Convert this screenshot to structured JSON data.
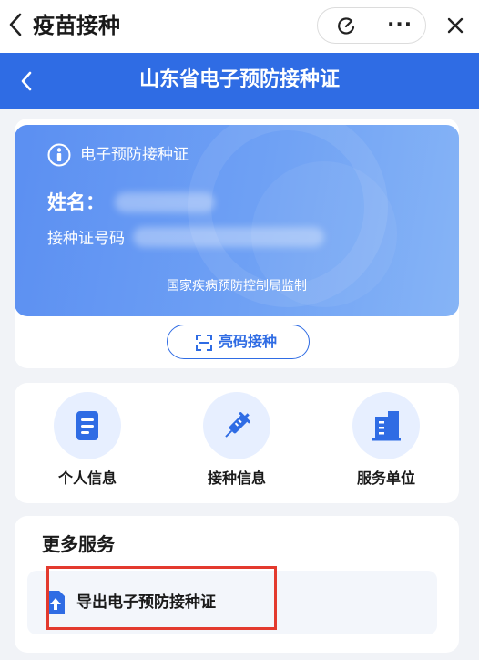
{
  "topbar": {
    "title": "疫苗接种",
    "more_glyph": "···"
  },
  "header": {
    "title": "山东省电子预防接种证"
  },
  "certificate": {
    "title": "电子预防接种证",
    "name_label": "姓名：",
    "id_label": "接种证号码",
    "footer": "国家疾病预防控制局监制"
  },
  "scan_button": {
    "label": "亮码接种"
  },
  "quick_services": [
    {
      "label": "个人信息",
      "icon": "document-icon"
    },
    {
      "label": "接种信息",
      "icon": "syringe-icon"
    },
    {
      "label": "服务单位",
      "icon": "building-icon"
    }
  ],
  "more_services": {
    "title": "更多服务",
    "items": [
      {
        "label": "导出电子预防接种证",
        "icon": "export-icon"
      }
    ]
  },
  "colors": {
    "primary": "#2f6ce4",
    "highlight": "#e33a2e",
    "background": "#f1f3f7"
  }
}
